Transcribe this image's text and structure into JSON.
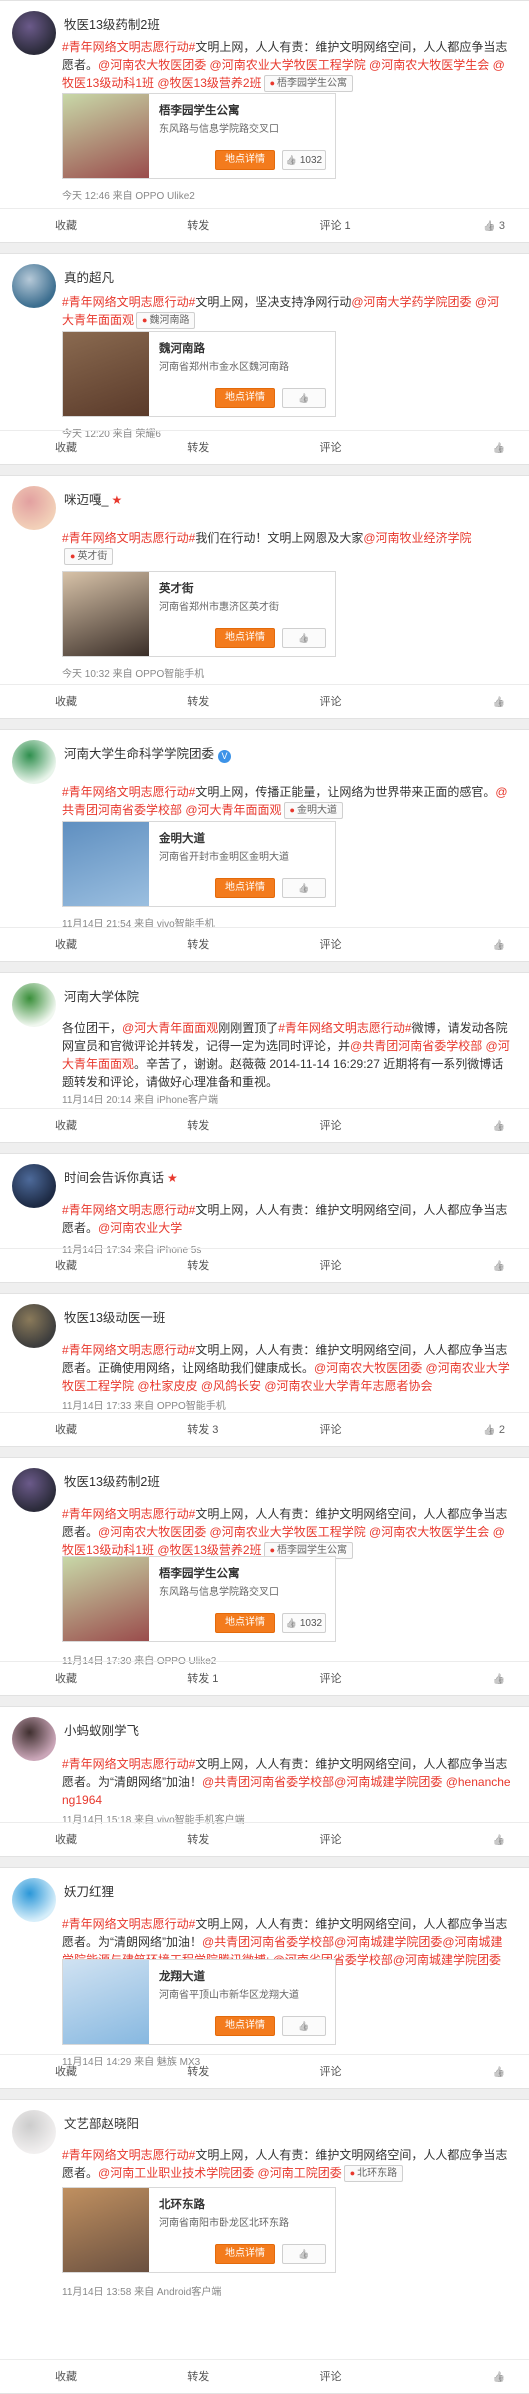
{
  "posts": [
    {
      "user": "牧医13级药制2班",
      "badge": "",
      "segments": [
        {
          "t": "#青年网络文明志愿行动#",
          "h": true
        },
        {
          "t": "文明上网，人人有责：维护文明网络空间，人人都应争当志愿者。",
          "h": false
        },
        {
          "t": "@河南农大牧医团委 @河南农业大学牧医工程学院 @河南农大牧医学生会 @牧医13级动科1班 @牧医13级营养2班",
          "h": true
        }
      ],
      "location": "梧李园学生公寓",
      "card": {
        "name": "梧李园学生公寓",
        "addr": "东风路与信息学院路交叉口",
        "btn": "地点详情",
        "likes": "1032"
      },
      "meta": "今天 12:46 来自 OPPO Ulike2",
      "actions": {
        "fav": "收藏",
        "repost": "转发",
        "comment": "评论 1",
        "like": "3"
      }
    },
    {
      "user": "真的超凡",
      "badge": "",
      "segments": [
        {
          "t": "#青年网络文明志愿行动#",
          "h": true
        },
        {
          "t": "文明上网，坚决支持净网行动",
          "h": false
        },
        {
          "t": "@河南大学药学院团委 @河大青年面面观",
          "h": true
        }
      ],
      "location": "魏河南路",
      "card": {
        "name": "魏河南路",
        "addr": "河南省郑州市金水区魏河南路",
        "btn": "地点详情",
        "likes": ""
      },
      "meta": "今天 12:20 来自 荣耀6",
      "actions": {
        "fav": "收藏",
        "repost": "转发",
        "comment": "评论",
        "like": ""
      }
    },
    {
      "user": "咪迈嘎_",
      "badge": "★",
      "segments": [
        {
          "t": "#青年网络文明志愿行动#",
          "h": true
        },
        {
          "t": "我们在行动！文明上网恩及大家",
          "h": false
        },
        {
          "t": "@河南牧业经济学院",
          "h": true
        }
      ],
      "location": "英才街",
      "card": {
        "name": "英才街",
        "addr": "河南省郑州市惠济区英才街",
        "btn": "地点详情",
        "likes": ""
      },
      "meta": "今天 10:32 来自 OPPO智能手机",
      "actions": {
        "fav": "收藏",
        "repost": "转发",
        "comment": "评论",
        "like": ""
      }
    },
    {
      "user": "河南大学生命科学学院团委",
      "badge": "V",
      "segments": [
        {
          "t": "#青年网络文明志愿行动#",
          "h": true
        },
        {
          "t": "文明上网，传播正能量，让网络为世界带来正面的感官。",
          "h": false
        },
        {
          "t": "@共青团河南省委学校部 @河大青年面面观",
          "h": true
        }
      ],
      "location": "金明大道",
      "card": {
        "name": "金明大道",
        "addr": "河南省开封市金明区金明大道",
        "btn": "地点详情",
        "likes": ""
      },
      "meta": "11月14日 21:54 来自 vivo智能手机",
      "actions": {
        "fav": "收藏",
        "repost": "转发",
        "comment": "评论",
        "like": ""
      }
    },
    {
      "user": "河南大学体院",
      "badge": "",
      "segments": [
        {
          "t": "各位团干，",
          "h": false
        },
        {
          "t": "@河大青年面面观",
          "h": true
        },
        {
          "t": "刚刚置顶了",
          "h": false
        },
        {
          "t": "#青年网络文明志愿行动#",
          "h": true
        },
        {
          "t": "微博，请发动各院网宣员和官微评论并转发，记得一定为选同时评论，并",
          "h": false
        },
        {
          "t": "@共青团河南省委学校部 @河大青年面面观",
          "h": true
        },
        {
          "t": "。辛苦了，谢谢。赵薇薇 2014-11-14 16:29:27 近期将有一系列微博话题转发和评论，请做好心理准备和重视。",
          "h": false
        }
      ],
      "location": "",
      "card": null,
      "meta": "11月14日 20:14 来自 iPhone客户端",
      "actions": {
        "fav": "收藏",
        "repost": "转发",
        "comment": "评论",
        "like": ""
      }
    },
    {
      "user": "时间会告诉你真话",
      "badge": "★",
      "segments": [
        {
          "t": "#青年网络文明志愿行动#",
          "h": true
        },
        {
          "t": "文明上网，人人有责：维护文明网络空间，人人都应争当志愿者。",
          "h": false
        },
        {
          "t": "@河南农业大学",
          "h": true
        }
      ],
      "location": "",
      "card": null,
      "meta": "11月14日 17:34 来自 iPhone 5s",
      "actions": {
        "fav": "收藏",
        "repost": "转发",
        "comment": "评论",
        "like": ""
      }
    },
    {
      "user": "牧医13级动医一班",
      "badge": "",
      "segments": [
        {
          "t": "#青年网络文明志愿行动#",
          "h": true
        },
        {
          "t": "文明上网，人人有责：维护文明网络空间，人人都应争当志愿者。正确使用网络，让网络助我们健康成长。",
          "h": false
        },
        {
          "t": "@河南农大牧医团委 @河南农业大学牧医工程学院 @杜家皮皮 @风鸽长安 @河南农业大学青年志愿者协会",
          "h": true
        }
      ],
      "location": "",
      "card": null,
      "meta": "11月14日 17:33 来自 OPPO智能手机",
      "actions": {
        "fav": "收藏",
        "repost": "转发 3",
        "comment": "评论",
        "like": "2"
      }
    },
    {
      "user": "牧医13级药制2班",
      "badge": "",
      "segments": [
        {
          "t": "#青年网络文明志愿行动#",
          "h": true
        },
        {
          "t": "文明上网，人人有责：维护文明网络空间，人人都应争当志愿者。",
          "h": false
        },
        {
          "t": "@河南农大牧医团委 @河南农业大学牧医工程学院 @河南农大牧医学生会 @牧医13级动科1班 @牧医13级营养2班",
          "h": true
        }
      ],
      "location": "梧李园学生公寓",
      "card": {
        "name": "梧李园学生公寓",
        "addr": "东风路与信息学院路交叉口",
        "btn": "地点详情",
        "likes": "1032"
      },
      "meta": "11月14日 17:30 来自 OPPO Ulike2",
      "actions": {
        "fav": "收藏",
        "repost": "转发 1",
        "comment": "评论",
        "like": ""
      }
    },
    {
      "user": "小蚂蚁刚学飞",
      "badge": "",
      "segments": [
        {
          "t": "#青年网络文明志愿行动#",
          "h": true
        },
        {
          "t": "文明上网，人人有责：维护文明网络空间，人人都应争当志愿者。为“清朗网络”加油！",
          "h": false
        },
        {
          "t": "@共青团河南省委学校部@河南城建学院团委 @henancheng1964",
          "h": true
        }
      ],
      "location": "",
      "card": null,
      "meta": "11月14日 15:18 来自 vivo智能手机客户端",
      "actions": {
        "fav": "收藏",
        "repost": "转发",
        "comment": "评论",
        "like": ""
      }
    },
    {
      "user": "妖刀红狸",
      "badge": "",
      "segments": [
        {
          "t": "#青年网络文明志愿行动#",
          "h": true
        },
        {
          "t": "文明上网，人人有责：维护文明网络空间，人人都应争当志愿者。为“清朗网络”加油！",
          "h": false
        },
        {
          "t": "@共青团河南省委学校部@河南城建学院团委@河南城建学院能源与建筑环境工程学院腾讯微博: @河南省团省委学校部@河南城建学院团委@henancheng1964",
          "h": true
        }
      ],
      "location": "龙翔大道",
      "card": {
        "name": "龙翔大道",
        "addr": "河南省平顶山市新华区龙翔大道",
        "btn": "地点详情",
        "likes": ""
      },
      "meta": "11月14日 14:29 来自 魅族 MX3",
      "actions": {
        "fav": "收藏",
        "repost": "转发",
        "comment": "评论",
        "like": ""
      }
    },
    {
      "user": "文艺部赵晓阳",
      "badge": "",
      "segments": [
        {
          "t": "#青年网络文明志愿行动#",
          "h": true
        },
        {
          "t": "文明上网，人人有责：维护文明网络空间，人人都应争当志愿者。",
          "h": false
        },
        {
          "t": "@河南工业职业技术学院团委 @河南工院团委",
          "h": true
        }
      ],
      "location": "北环东路",
      "card": {
        "name": "北环东路",
        "addr": "河南省南阳市卧龙区北环东路",
        "btn": "地点详情",
        "likes": ""
      },
      "meta": "11月14日 13:58 来自 Android客户端",
      "actions": {
        "fav": "收藏",
        "repost": "转发",
        "comment": "评论",
        "like": ""
      }
    }
  ],
  "colors": {
    "accent": "#e8382d",
    "button": "#f37b1d",
    "link": "#e8382d"
  }
}
